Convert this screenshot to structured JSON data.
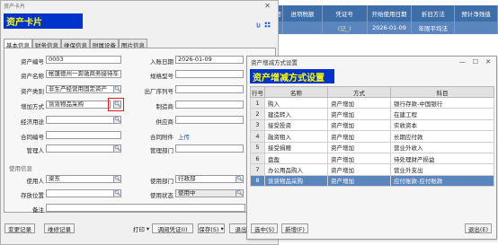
{
  "background_grid": {
    "headers": [
      "摘要",
      "进项税额",
      "凭证号",
      "开始使用日期",
      "折旧方法",
      "预计净残值"
    ],
    "row": [
      "",
      "",
      "(记_)",
      "2026-01-09",
      "年限平均法",
      ""
    ]
  },
  "card": {
    "window_title": "资产卡片",
    "banner": "资产卡片",
    "tabs": [
      "基本信息",
      "财务信息",
      "维保信息",
      "附属设备",
      "图片信息"
    ],
    "fields": {
      "asset_code": {
        "label": "资产编号",
        "value": "0003"
      },
      "asset_name": {
        "label": "资产名称",
        "value": "帐篷德州一奔驰商务接待车"
      },
      "asset_category": {
        "label": "资产类别",
        "value": "非生产经营用固定资产"
      },
      "increase_method": {
        "label": "增加方式",
        "value": "赁赁物品采购"
      },
      "manager_dept": {
        "label": "经济用途",
        "value": ""
      },
      "contract_no": {
        "label": "合同编号",
        "value": ""
      },
      "manager": {
        "label": "管理人",
        "value": ""
      },
      "entry_date": {
        "label": "入账日期",
        "value": "2026-01-09"
      },
      "spec_model": {
        "label": "规格型号",
        "value": ""
      },
      "serial_no": {
        "label": "出厂序列号",
        "value": ""
      },
      "manufacturer": {
        "label": "制造商",
        "value": ""
      },
      "supplier": {
        "label": "供应商",
        "value": ""
      },
      "contract_attach": {
        "label": "合同附件",
        "link": "上传"
      },
      "mgmt_dept": {
        "label": "管理部门",
        "value": ""
      },
      "user": {
        "label": "使用人",
        "value": "梁东"
      },
      "location": {
        "label": "存放位置",
        "value": ""
      },
      "remark": {
        "label": "备注",
        "value": ""
      },
      "use_dept": {
        "label": "使用部门",
        "value": "行政部"
      },
      "use_status": {
        "label": "使用状态",
        "value": "使用中"
      }
    },
    "section_use": "使用信息",
    "buttons": {
      "change_log": "变更记录",
      "maintenance_log": "维修记录",
      "print": "打印",
      "adjust_voucher": "调阅凭证(I)",
      "save": "保存(S)",
      "close": "退出"
    }
  },
  "dialog": {
    "window_title": "资产增减方式设置",
    "banner": "资产增减方式设置",
    "columns": [
      "行号",
      "名称",
      "方式",
      "科目"
    ],
    "rows": [
      [
        "1",
        "购入",
        "资产增加",
        "银行存款-中国银行"
      ],
      [
        "2",
        "建造转入",
        "资产增加",
        "在建工程"
      ],
      [
        "3",
        "接受投资",
        "资产增加",
        "实收资本"
      ],
      [
        "4",
        "融资租入",
        "资产增加",
        "长期应付款"
      ],
      [
        "5",
        "接受捐赠",
        "资产增加",
        "营业外收入"
      ],
      [
        "6",
        "盘盈",
        "资产增加",
        "待处理财产损益"
      ],
      [
        "7",
        "办公用品购入",
        "资产增加",
        "营业外支出"
      ],
      [
        "8",
        "赁赁物品采购",
        "资产增加",
        "应付账款-应付账款"
      ]
    ],
    "selected_row": 8,
    "buttons": {
      "select": "选中(S)",
      "add": "新增(F)",
      "exit": "退出(E)"
    }
  },
  "colors": {
    "banner_bg": "#0033cc",
    "banner_text": "#ffff00",
    "selection": "#5b86bd",
    "highlight": "#e02020"
  }
}
